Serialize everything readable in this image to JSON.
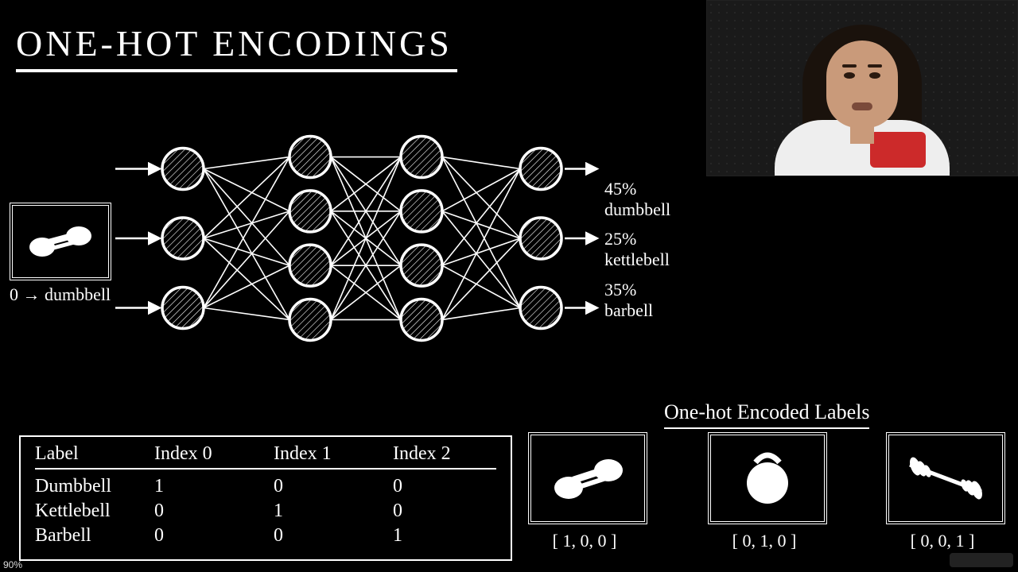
{
  "title": "ONE-HOT ENCODINGS",
  "input_label": "0 → dumbbell",
  "outputs": [
    {
      "pct": "45%",
      "name": "dumbbell"
    },
    {
      "pct": "25%",
      "name": "kettlebell"
    },
    {
      "pct": "35%",
      "name": "barbell"
    }
  ],
  "table": {
    "headers": [
      "Label",
      "Index 0",
      "Index 1",
      "Index 2"
    ],
    "rows": [
      [
        "Dumbbell",
        "1",
        "0",
        "0"
      ],
      [
        "Kettlebell",
        "0",
        "1",
        "0"
      ],
      [
        "Barbell",
        "0",
        "0",
        "1"
      ]
    ]
  },
  "encoded": {
    "title": "One-hot Encoded Labels",
    "items": [
      {
        "icon": "dumbbell",
        "vector": "[ 1, 0, 0 ]"
      },
      {
        "icon": "kettlebell",
        "vector": "[ 0, 1, 0 ]"
      },
      {
        "icon": "barbell",
        "vector": "[ 0, 0, 1 ]"
      }
    ]
  },
  "network": {
    "layers": [
      3,
      4,
      4,
      3
    ]
  },
  "zoom": "90%"
}
